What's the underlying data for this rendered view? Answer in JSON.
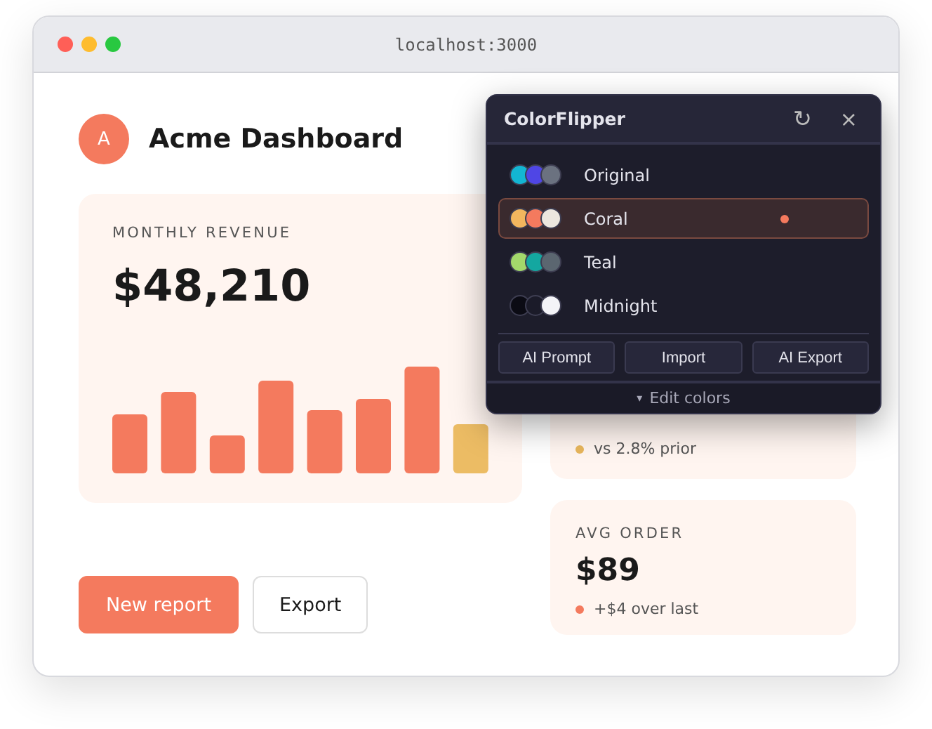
{
  "browser": {
    "address": "localhost:3000"
  },
  "header": {
    "avatar": "A",
    "title": "Acme Dashboard"
  },
  "revenue": {
    "label": "MONTHLY REVENUE",
    "value": "$48,210"
  },
  "actions": [
    {
      "label": "New report",
      "kind": "primary"
    },
    {
      "label": "Export",
      "kind": "secondary"
    }
  ],
  "stats": [
    {
      "note": "vs 2.8% prior",
      "color": "#e8b65c"
    },
    {
      "label": "AVG ORDER",
      "value": "$89",
      "note": "+$4 over last",
      "color": "#f47a5e"
    }
  ],
  "popup": {
    "title": "ColorFlipper",
    "reset": "↻",
    "close": "×",
    "palettes": [
      {
        "name": "Original",
        "selected": false,
        "swatches": [
          {
            "color": "#13b6d3"
          },
          {
            "color": "#4f46e5"
          },
          {
            "color": "#6b7280"
          }
        ]
      },
      {
        "name": "Coral",
        "selected": true,
        "swatches": [
          {
            "color": "#f2b65e"
          },
          {
            "color": "#f47a5e"
          },
          {
            "color": "#ece7df"
          }
        ]
      },
      {
        "name": "Teal",
        "selected": false,
        "swatches": [
          {
            "color": "#a3d86b"
          },
          {
            "color": "#14a7a0"
          },
          {
            "color": "#5b6670"
          }
        ]
      },
      {
        "name": "Midnight",
        "selected": false,
        "swatches": [
          {
            "color": "#0b0b14"
          },
          {
            "color": "#1b1b29"
          },
          {
            "color": "#f4f4f8"
          }
        ]
      }
    ],
    "buttons": [
      "AI Prompt",
      "Import",
      "AI Export"
    ],
    "footer": {
      "caret": "▾",
      "label": "Edit colors"
    }
  }
}
